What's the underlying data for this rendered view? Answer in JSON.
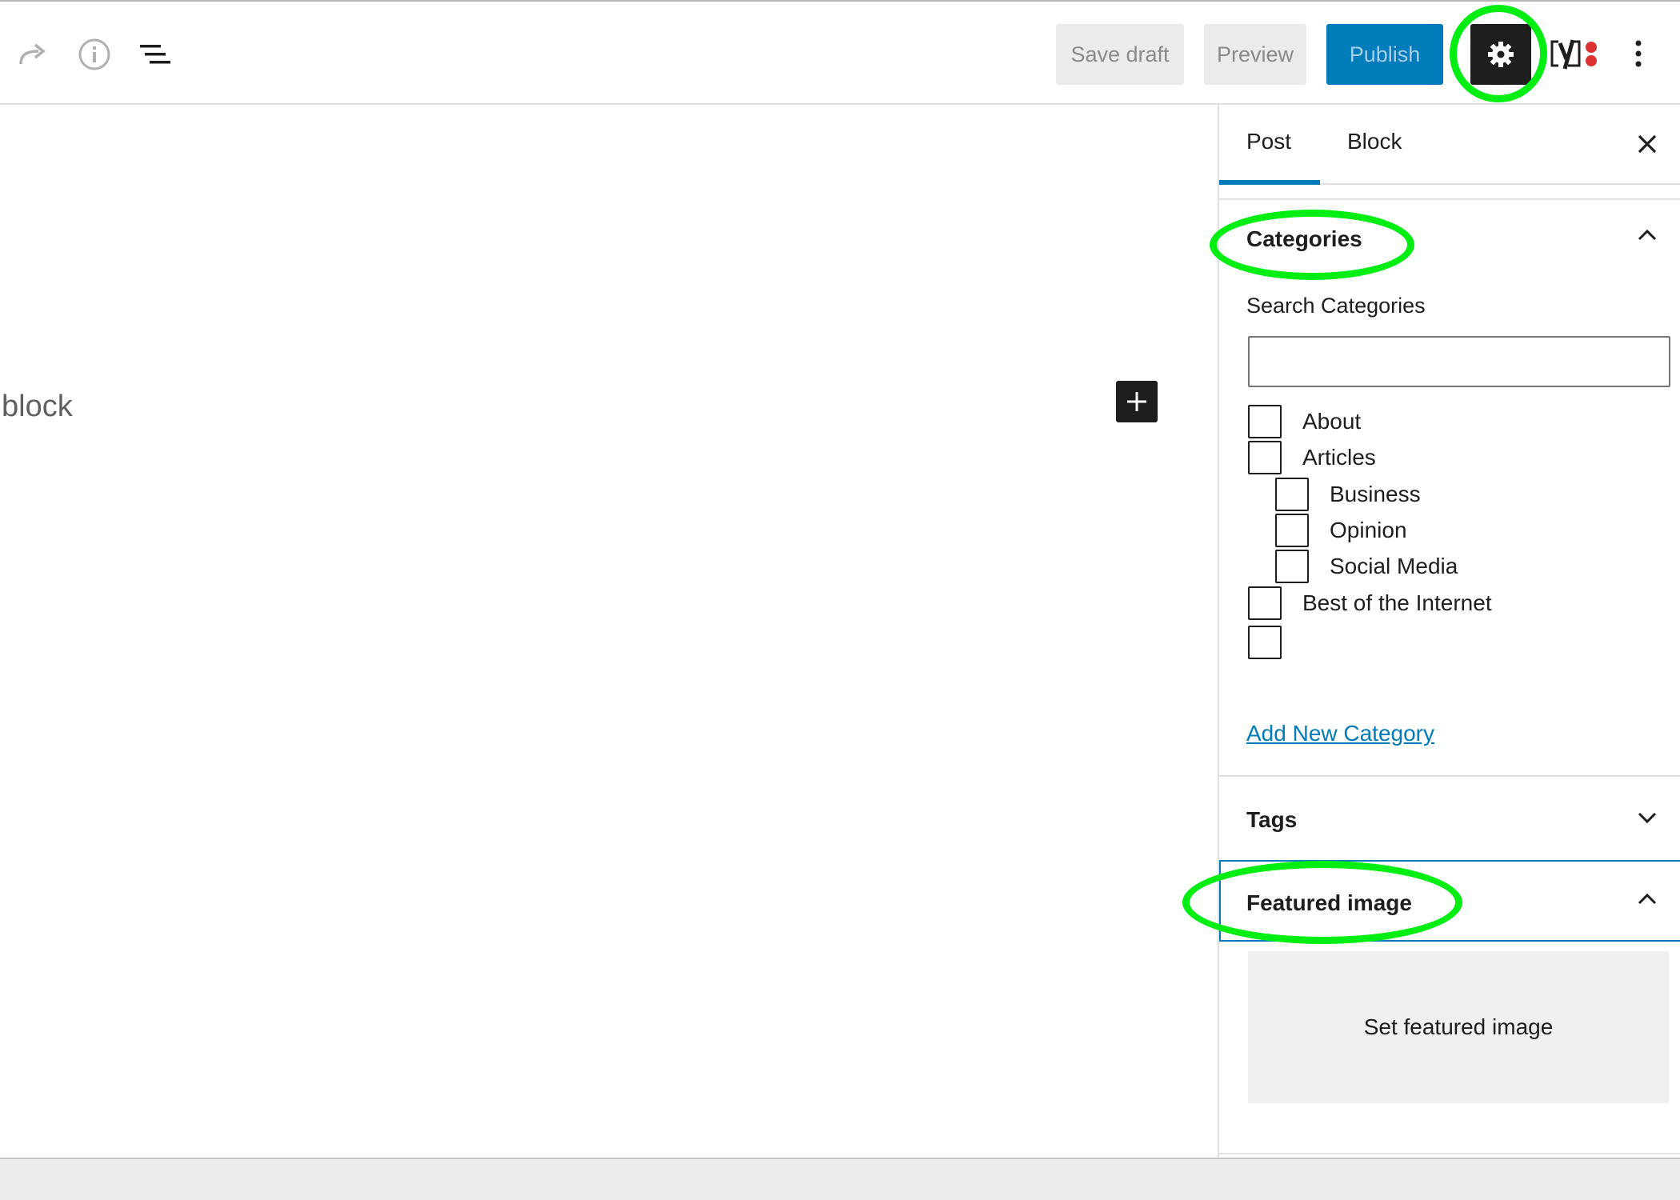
{
  "toolbar": {
    "icons": [
      "redo-icon",
      "info-icon",
      "list-view-icon",
      "gear-icon",
      "yoast-icon",
      "more-options-icon"
    ],
    "save_draft_label": "Save draft",
    "preview_label": "Preview",
    "publish_label": "Publish"
  },
  "editor": {
    "block_hint": "block",
    "inserter_icon": "plus-icon"
  },
  "sidebar": {
    "tabs": [
      {
        "label": "Post",
        "active": true
      },
      {
        "label": "Block",
        "active": false
      }
    ],
    "categories": {
      "title": "Categories",
      "search_label": "Search Categories",
      "search_value": "",
      "items": [
        {
          "label": "About",
          "checked": false,
          "level": 0
        },
        {
          "label": "Articles",
          "checked": false,
          "level": 0
        },
        {
          "label": "Business",
          "checked": false,
          "level": 1
        },
        {
          "label": "Opinion",
          "checked": false,
          "level": 1
        },
        {
          "label": "Social Media",
          "checked": false,
          "level": 1
        },
        {
          "label": "Best of the Internet",
          "checked": false,
          "level": 0
        }
      ],
      "add_new_label": "Add New Category"
    },
    "tags": {
      "title": "Tags"
    },
    "featured_image": {
      "title": "Featured image",
      "set_label": "Set featured image"
    }
  },
  "colors": {
    "accent": "#007cba",
    "highlight": "#00ee11",
    "dark": "#1e1e1e"
  }
}
